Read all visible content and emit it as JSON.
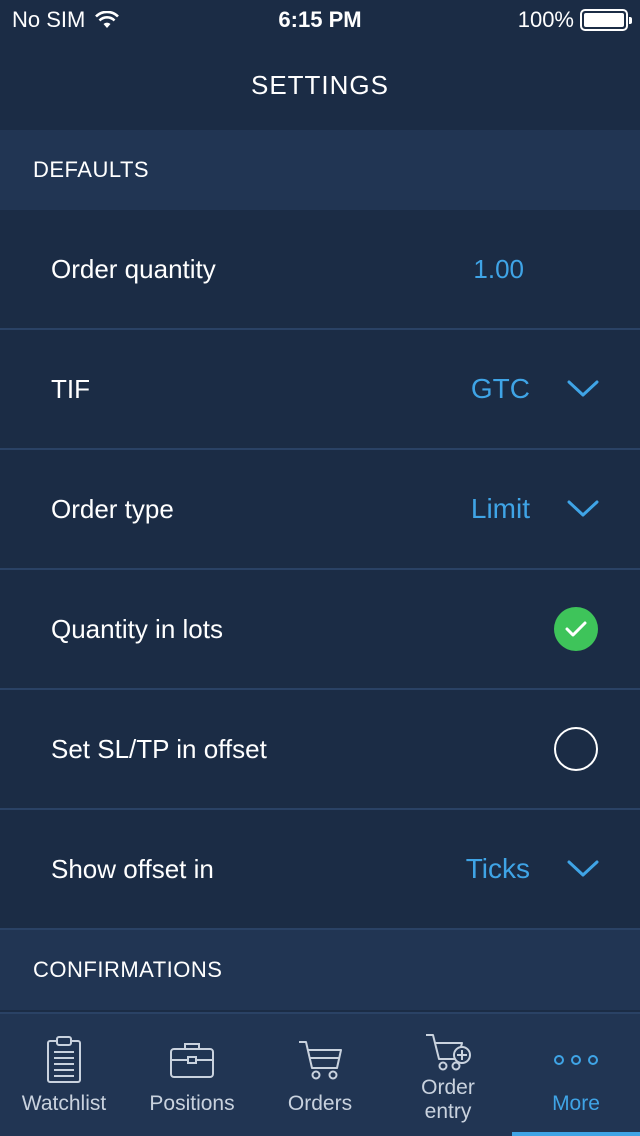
{
  "status_bar": {
    "carrier": "No SIM",
    "time": "6:15 PM",
    "battery": "100%"
  },
  "header": {
    "title": "SETTINGS"
  },
  "sections": [
    {
      "title": "DEFAULTS",
      "rows": [
        {
          "label": "Order quantity",
          "value": "1.00"
        },
        {
          "label": "TIF",
          "value": "GTC"
        },
        {
          "label": "Order type",
          "value": "Limit"
        },
        {
          "label": "Quantity in lots",
          "checked": true
        },
        {
          "label": "Set SL/TP in offset",
          "checked": false
        },
        {
          "label": "Show offset in",
          "value": "Ticks"
        }
      ]
    },
    {
      "title": "CONFIRMATIONS"
    }
  ],
  "tab_bar": {
    "tabs": [
      {
        "label": "Watchlist",
        "icon": "clipboard-icon"
      },
      {
        "label": "Positions",
        "icon": "briefcase-icon"
      },
      {
        "label": "Orders",
        "icon": "cart-icon"
      },
      {
        "label": "Order\nentry",
        "icon": "cart-add-icon"
      },
      {
        "label": "More",
        "icon": "more-dots-icon",
        "active": true
      }
    ]
  },
  "colors": {
    "background": "#1b2c45",
    "section_bg": "#213553",
    "accent": "#3fa4e6",
    "check_green": "#3ec45a"
  }
}
